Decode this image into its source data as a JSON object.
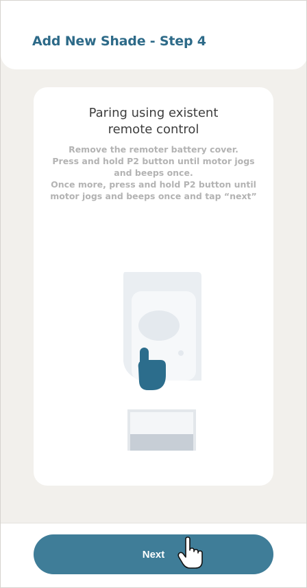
{
  "header": {
    "title": "Add New Shade - Step 4"
  },
  "card": {
    "title": "Paring using existent\nremote control",
    "instructions": "Remove the remoter battery cover.\nPress and hold P2 button until motor jogs\nand beeps once.\nOnce more, press and hold P2 button until\nmotor jogs and beeps once and tap “next”"
  },
  "footer": {
    "next_label": "Next"
  },
  "colors": {
    "accent": "#3f7d98",
    "title": "#2d6a88",
    "background": "#f2f0ec",
    "hand": "#2c6d8c"
  },
  "icons": {
    "illustration": "remote-pairing-illustration",
    "hand": "pointing-hand-icon",
    "cursor": "hand-cursor-icon"
  }
}
